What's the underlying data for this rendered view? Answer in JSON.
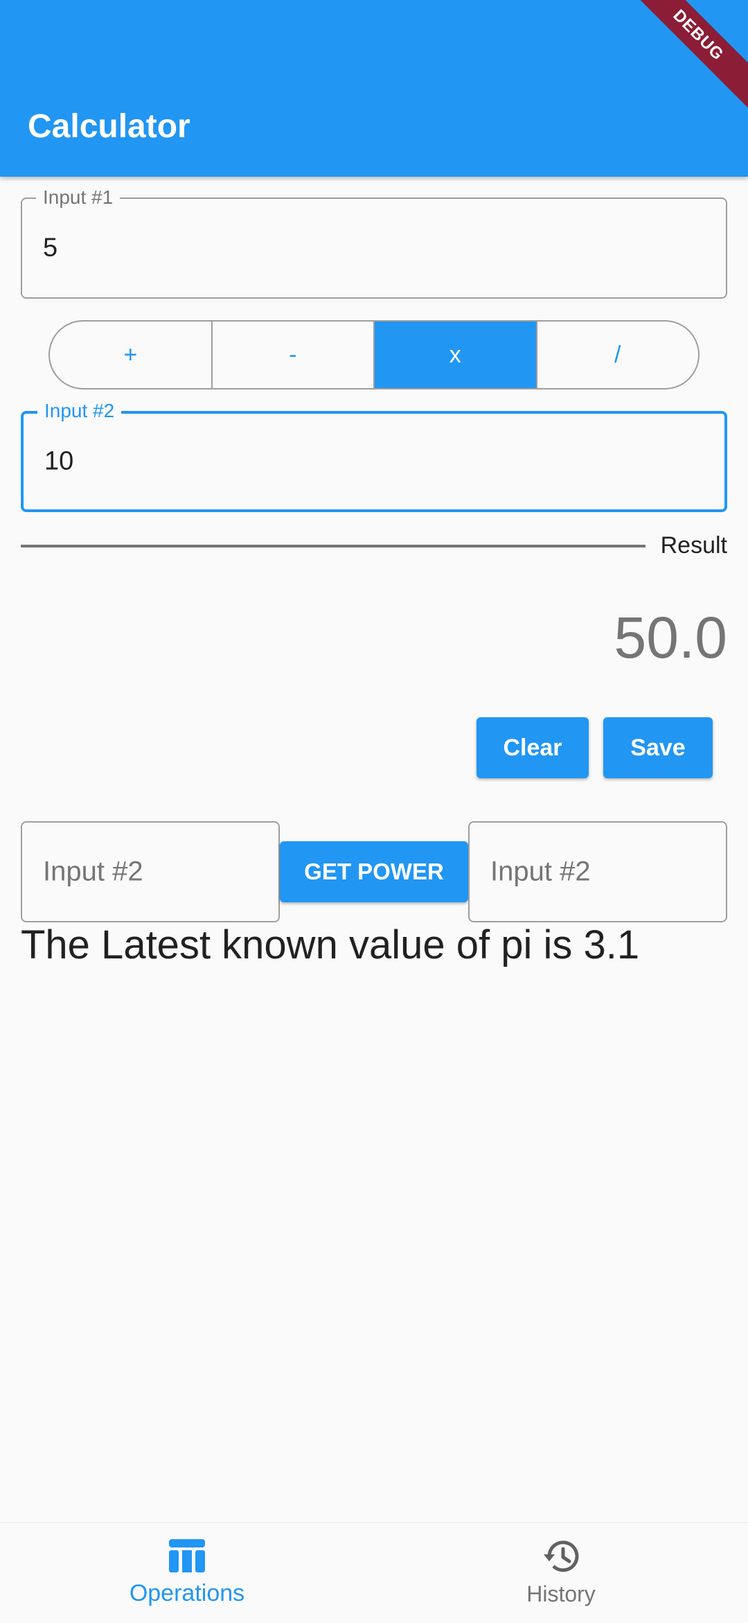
{
  "appbar": {
    "title": "Calculator",
    "debug_label": "DEBUG"
  },
  "input1": {
    "label": "Input #1",
    "value": "5"
  },
  "operations": {
    "items": [
      "+",
      "-",
      "x",
      "/"
    ],
    "selected": "x"
  },
  "input2": {
    "label": "Input #2",
    "value": "10"
  },
  "result": {
    "label": "Result",
    "value": "50.0"
  },
  "actions": {
    "clear_label": "Clear",
    "save_label": "Save"
  },
  "power": {
    "left_placeholder": "Input #2",
    "button_label": "GET POWER",
    "right_placeholder": "Input #2"
  },
  "pi_text": "The Latest known value of pi is 3.1",
  "bottom_nav": {
    "items": [
      {
        "label": "Operations",
        "icon": "table-icon",
        "active": true
      },
      {
        "label": "History",
        "icon": "history-icon",
        "active": false
      }
    ]
  },
  "colors": {
    "primary": "#2196f3",
    "debug_banner": "#8b1d36",
    "background": "#fafafa"
  }
}
